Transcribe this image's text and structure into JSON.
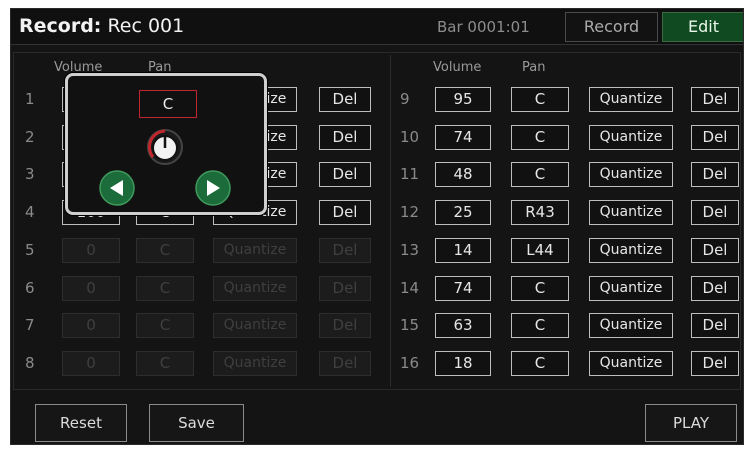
{
  "header": {
    "title_bold": "Record:",
    "title_rest": " Rec 001",
    "bar_indicator": "Bar 0001:01",
    "record_tab": "Record",
    "edit_tab": "Edit"
  },
  "columns": {
    "volume": "Volume",
    "pan": "Pan"
  },
  "left_tracks": [
    {
      "num": "1",
      "volume": "",
      "pan": "",
      "quantize": "Quantize",
      "del": "Del",
      "enabled": true
    },
    {
      "num": "2",
      "volume": "",
      "pan": "",
      "quantize": "Quantize",
      "del": "Del",
      "enabled": true
    },
    {
      "num": "3",
      "volume": "",
      "pan": "",
      "quantize": "Quantize",
      "del": "Del",
      "enabled": true
    },
    {
      "num": "4",
      "volume": "100",
      "pan": "C",
      "quantize": "Quantize",
      "del": "Del",
      "enabled": true
    },
    {
      "num": "5",
      "volume": "0",
      "pan": "C",
      "quantize": "Quantize",
      "del": "Del",
      "enabled": false
    },
    {
      "num": "6",
      "volume": "0",
      "pan": "C",
      "quantize": "Quantize",
      "del": "Del",
      "enabled": false
    },
    {
      "num": "7",
      "volume": "0",
      "pan": "C",
      "quantize": "Quantize",
      "del": "Del",
      "enabled": false
    },
    {
      "num": "8",
      "volume": "0",
      "pan": "C",
      "quantize": "Quantize",
      "del": "Del",
      "enabled": false
    }
  ],
  "right_tracks": [
    {
      "num": "9",
      "volume": "95",
      "pan": "C",
      "quantize": "Quantize",
      "del": "Del"
    },
    {
      "num": "10",
      "volume": "74",
      "pan": "C",
      "quantize": "Quantize",
      "del": "Del"
    },
    {
      "num": "11",
      "volume": "48",
      "pan": "C",
      "quantize": "Quantize",
      "del": "Del"
    },
    {
      "num": "12",
      "volume": "25",
      "pan": "R43",
      "quantize": "Quantize",
      "del": "Del"
    },
    {
      "num": "13",
      "volume": "14",
      "pan": "L44",
      "quantize": "Quantize",
      "del": "Del"
    },
    {
      "num": "14",
      "volume": "74",
      "pan": "C",
      "quantize": "Quantize",
      "del": "Del"
    },
    {
      "num": "15",
      "volume": "63",
      "pan": "C",
      "quantize": "Quantize",
      "del": "Del"
    },
    {
      "num": "16",
      "volume": "18",
      "pan": "C",
      "quantize": "Quantize",
      "del": "Del"
    }
  ],
  "popup": {
    "value": "C",
    "knob_icon": "knob-icon",
    "prev_icon": "arrow-left-icon",
    "next_icon": "arrow-right-icon",
    "accent_color": "#c0272d",
    "arrow_color": "#1c6b3a"
  },
  "footer": {
    "reset": "Reset",
    "save": "Save",
    "play": "PLAY"
  }
}
